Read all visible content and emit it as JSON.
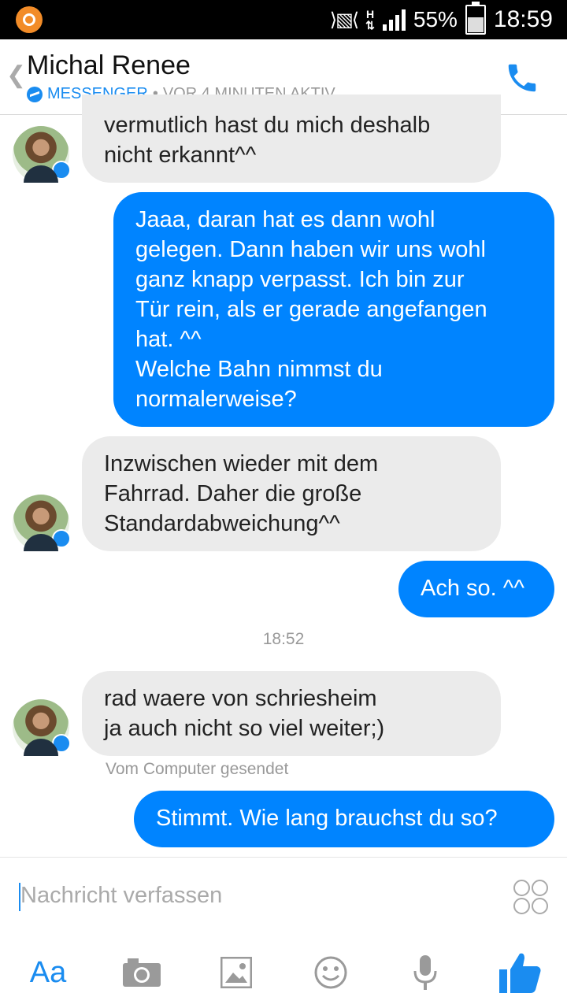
{
  "status_bar": {
    "network": "H",
    "battery": "55%",
    "battery_level": 0.55,
    "time": "18:59"
  },
  "header": {
    "contact_name": "Michal Renee",
    "platform": "MESSENGER",
    "separator": "•",
    "active_status": "VOR 4 MINUTEN AKTIV",
    "icons": [
      "back-arrow-icon",
      "phone-icon"
    ]
  },
  "messages": [
    {
      "direction": "in",
      "text": "vermutlich hast du mich deshalb\nnicht erkannt^^"
    },
    {
      "direction": "out",
      "text": "Jaaa, daran hat es dann wohl\ngelegen. Dann haben wir uns wohl\nganz knapp verpasst. Ich bin zur\nTür rein, als er gerade angefangen\nhat. ^^\nWelche Bahn nimmst du\nnormalerweise?"
    },
    {
      "direction": "in",
      "text": "Inzwischen wieder mit dem\nFahrrad. Daher die große\nStandardabweichung^^"
    },
    {
      "direction": "out",
      "text": "Ach so. ^^"
    },
    {
      "direction": "in",
      "text": "rad waere von schriesheim\nja auch nicht so viel weiter;)"
    },
    {
      "direction": "out",
      "text": "Stimmt. Wie lang brauchst du so?"
    }
  ],
  "timestamp": "18:52",
  "sent_from_note": "Vom Computer gesendet",
  "composer": {
    "placeholder": "Nachricht verfassen"
  },
  "toolbar": {
    "aa_label": "Aa",
    "icons": [
      "camera-icon",
      "gallery-icon",
      "emoji-icon",
      "microphone-icon",
      "like-icon"
    ]
  },
  "colors": {
    "accent": "#0084ff",
    "incoming_bubble": "#ebebeb"
  }
}
